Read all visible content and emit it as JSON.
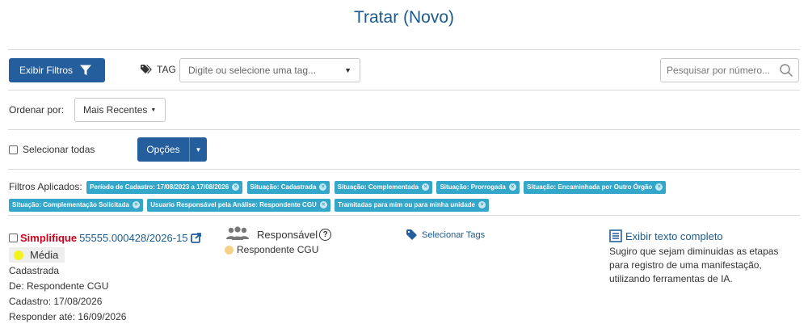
{
  "page": {
    "title": "Tratar (Novo)"
  },
  "toolbar": {
    "filters_button": "Exibir Filtros",
    "tag_label": "TAG",
    "tag_placeholder": "Digite ou selecione uma tag...",
    "search_placeholder": "Pesquisar por número..."
  },
  "ordering": {
    "label": "Ordenar por:",
    "value": "Mais Recentes"
  },
  "selection": {
    "select_all": "Selecionar todas",
    "options_button": "Opções"
  },
  "applied_filters": {
    "label": "Filtros Aplicados:",
    "chips": [
      "Período de Cadastro: 17/08/2023 a 17/08/2026",
      "Situação: Cadastrada",
      "Situação: Complementada",
      "Situação: Prorrogada",
      "Situação: Encaminhada por Outro Órgão",
      "Situação: Complementação Solicitada",
      "Usuario Responsável pela Análise: Respondente CGU",
      "Tramitadas para mim ou para minha unidade"
    ]
  },
  "item": {
    "type": "Simplifique",
    "number": "55555.000428/2026-15",
    "priority": "Média",
    "priority_color": "#f2f21f",
    "status": "Cadastrada",
    "from": "De: Respondente CGU",
    "created": "Cadastro: 17/08/2026",
    "due": "Responder até: 16/09/2026",
    "responsible_label": "Responsável",
    "responsible_value": "Respondente CGU",
    "select_tags": "Selecionar Tags",
    "show_full_text": "Exibir texto completo",
    "summary": "Sugiro que sejam diminuidas as etapas para registro de uma manifestação, utilizando ferramentas de IA."
  },
  "colors": {
    "primary": "#245e9d",
    "chip": "#33a7c9",
    "title": "#1b5a8c",
    "type_red": "#d0021b"
  }
}
